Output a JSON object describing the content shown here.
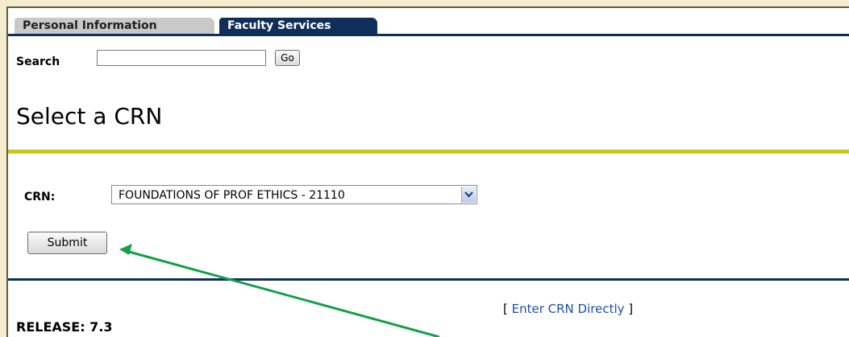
{
  "tabs": [
    {
      "label": "Personal Information",
      "active": false
    },
    {
      "label": "Faculty Services",
      "active": true
    }
  ],
  "search": {
    "label": "Search",
    "value": "",
    "go_label": "Go"
  },
  "page": {
    "title": "Select a CRN"
  },
  "crn": {
    "label": "CRN:",
    "selected": "FOUNDATIONS OF PROF ETHICS - 21110"
  },
  "submit_label": "Submit",
  "footer": {
    "link_prefix": "[ ",
    "link_label": "Enter CRN Directly",
    "link_suffix": " ]",
    "release": "RELEASE: 7.3"
  },
  "colors": {
    "navy": "#0f2e5a",
    "gold_rule": "#c9c718",
    "annotation_arrow": "#12a04a",
    "page_background": "#f4eccb",
    "link": "#1a4fb0"
  },
  "icons": {
    "select_arrow": "chevron-down-icon",
    "annotation": "arrow-annotation-icon"
  }
}
